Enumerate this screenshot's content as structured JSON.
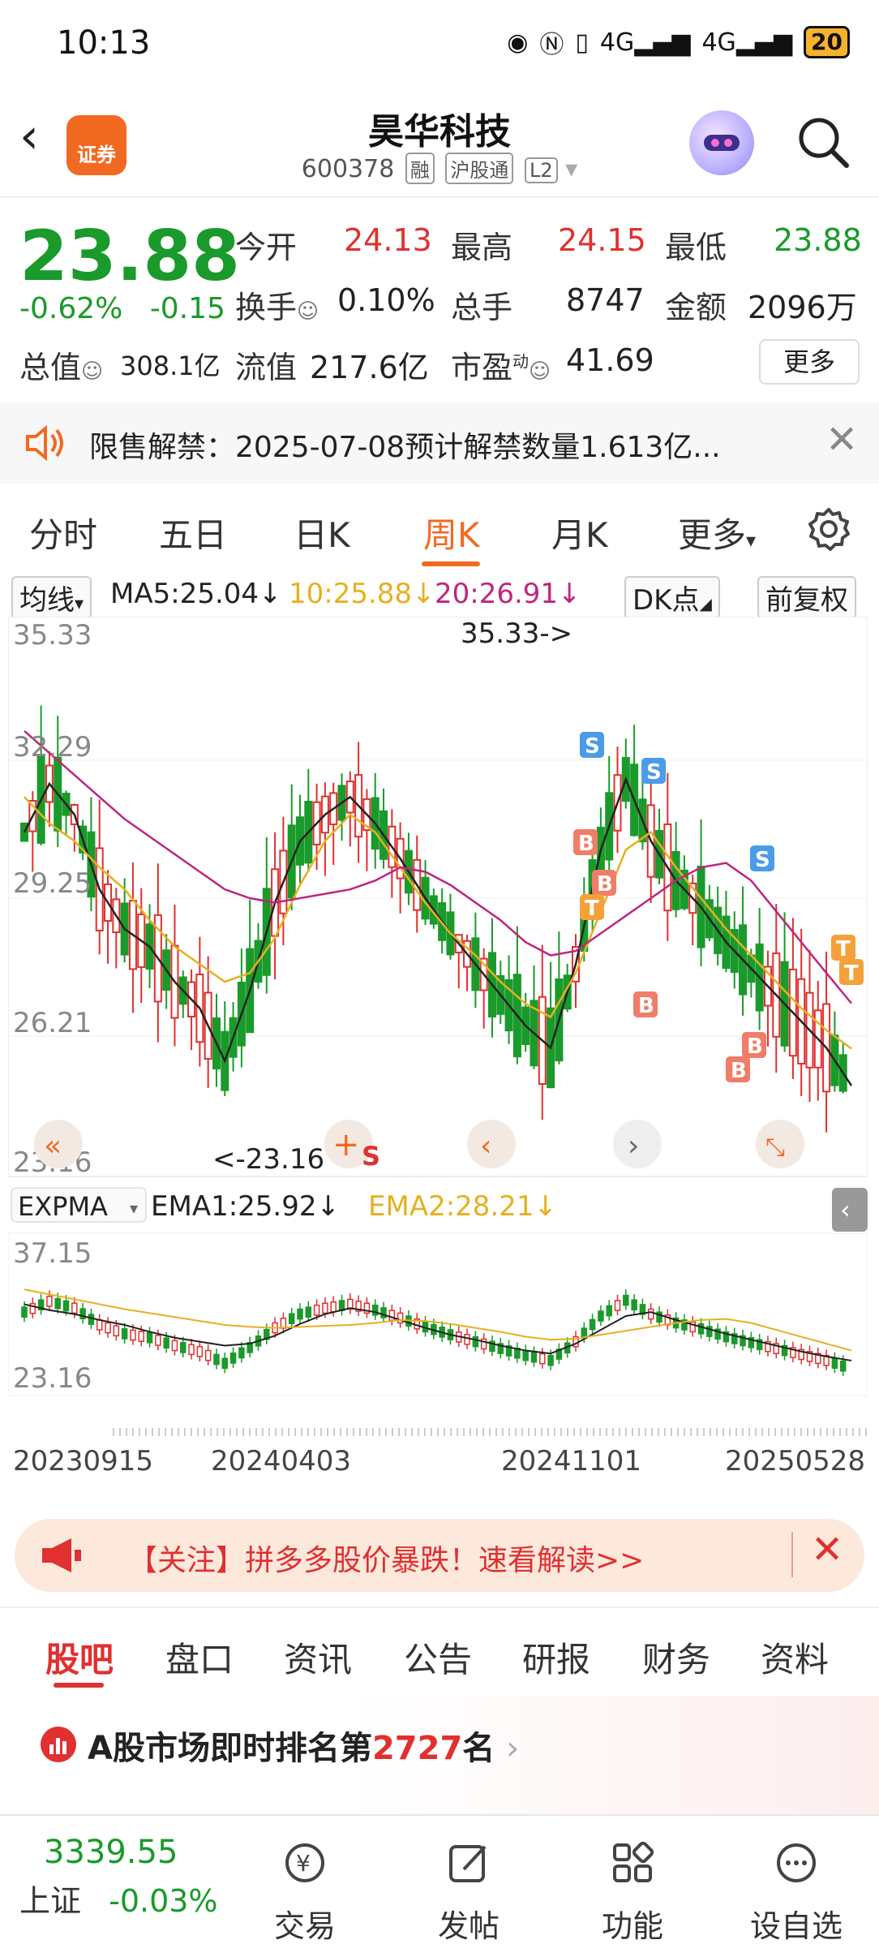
{
  "status": {
    "time": "10:13",
    "network_1": "4G",
    "network_2": "4G",
    "battery": "20"
  },
  "header": {
    "back_glyph": "‹",
    "logo_text": "证券",
    "stock_name": "昊华科技",
    "stock_code": "600378",
    "tags": [
      "融",
      "沪股通",
      "L2"
    ]
  },
  "quote": {
    "price": "23.88",
    "change_pct": "-0.62%",
    "change_abs": "-0.15",
    "open_label": "今开",
    "open": "24.13",
    "high_label": "最高",
    "high": "24.15",
    "low_label": "最低",
    "low": "23.88",
    "turnover_label": "换手",
    "turnover": "0.10%",
    "volume_label": "总手",
    "volume": "8747",
    "amount_label": "金额",
    "amount": "2096万",
    "total_value_label": "总值",
    "total_value": "308.1亿",
    "float_value_label": "流值",
    "float_value": "217.6亿",
    "pe_label": "市盈",
    "pe_sup": "动",
    "pe": "41.69",
    "more_button": "更多"
  },
  "notice": {
    "text": "限售解禁：2025-07-08预计解禁数量1.613亿..."
  },
  "tabs": [
    "分时",
    "五日",
    "日K",
    "周K",
    "月K",
    "更多"
  ],
  "active_tab": "周K",
  "chart_header": {
    "ma_select": "均线",
    "ma5": "MA5:25.04↓",
    "ma10": "10:25.88↓",
    "ma20": "20:26.91↓",
    "dk_button": "DK点",
    "adjust_button": "前复权"
  },
  "colors": {
    "up": "#e0302f",
    "down": "#1a9a2a",
    "ma5": "#222222",
    "ma10": "#e8b020",
    "ma20": "#c0257e",
    "accent": "#f26a21"
  },
  "chart_data": [
    {
      "type": "candlestick",
      "title": "",
      "y_ticks": [
        "35.33",
        "32.29",
        "29.25",
        "26.21",
        "23.16"
      ],
      "ylim": [
        23.16,
        35.33
      ],
      "high_marker": "35.33->",
      "low_marker": "<-23.16",
      "signal_labels": [
        "S",
        "S",
        "S",
        "B",
        "B",
        "B",
        "B",
        "B",
        "T",
        "T",
        "T"
      ],
      "series": [
        {
          "name": "MA5",
          "values": [
            30.8,
            31.9,
            31.2,
            29.5,
            28.6,
            28.2,
            27.4,
            26.8,
            25.6,
            27.2,
            29.2,
            30.6,
            31.2,
            31.6,
            31.0,
            30.2,
            29.3,
            28.5,
            27.8,
            27.1,
            26.4,
            25.9,
            27.8,
            30.4,
            32.0,
            30.6,
            29.7,
            29.1,
            28.3,
            27.7,
            27.1,
            26.5,
            25.9,
            25.04
          ]
        },
        {
          "name": "MA10",
          "values": [
            31.6,
            31.0,
            30.6,
            30.0,
            29.5,
            28.8,
            28.2,
            27.8,
            27.4,
            27.6,
            28.4,
            29.6,
            30.6,
            31.2,
            30.8,
            30.0,
            29.2,
            28.5,
            28.0,
            27.4,
            26.9,
            26.6,
            27.6,
            29.0,
            30.4,
            30.8,
            30.0,
            29.3,
            28.6,
            28.0,
            27.4,
            26.8,
            26.3,
            25.88
          ]
        },
        {
          "name": "MA20",
          "values": [
            33.1,
            32.6,
            32.1,
            31.6,
            31.1,
            30.7,
            30.3,
            29.9,
            29.5,
            29.3,
            29.2,
            29.3,
            29.4,
            29.5,
            29.7,
            30.0,
            29.9,
            29.6,
            29.2,
            28.8,
            28.3,
            28.0,
            28.1,
            28.5,
            28.9,
            29.3,
            29.7,
            30.0,
            30.1,
            29.7,
            29.0,
            28.3,
            27.6,
            26.91
          ]
        }
      ]
    },
    {
      "type": "line",
      "title": "",
      "indicator": "EXPMA",
      "ema1": "EMA1:25.92↓",
      "ema2": "EMA2:28.21↓",
      "y_ticks": [
        "37.15",
        "23.16"
      ],
      "x_ticks": [
        "20230915",
        "20240403",
        "20241101",
        "20250528"
      ]
    }
  ],
  "banner": {
    "text": "【关注】拼多多股价暴跌！速看解读>>"
  },
  "subtabs": [
    "股吧",
    "盘口",
    "资讯",
    "公告",
    "研报",
    "财务",
    "资料"
  ],
  "active_subtab": "股吧",
  "rank": {
    "prefix": "A股市场即时排名第",
    "number": "2727",
    "suffix": "名"
  },
  "bottom_nav": {
    "index_value": "3339.55",
    "index_name": "上证",
    "index_change": "-0.03%",
    "items": [
      "交易",
      "发帖",
      "功能",
      "设自选"
    ]
  }
}
